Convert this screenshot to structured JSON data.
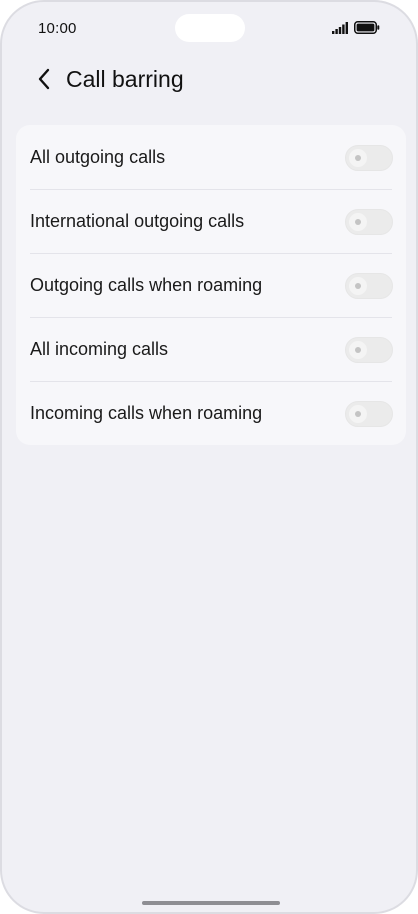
{
  "status_bar": {
    "time": "10:00",
    "icons": [
      "signal-icon",
      "battery-icon"
    ]
  },
  "header": {
    "back_icon": "chevron-left-icon",
    "title": "Call barring"
  },
  "settings": {
    "items": [
      {
        "label": "All outgoing calls",
        "enabled": false
      },
      {
        "label": "International outgoing calls",
        "enabled": false
      },
      {
        "label": "Outgoing calls when roaming",
        "enabled": false
      },
      {
        "label": "All incoming calls",
        "enabled": false
      },
      {
        "label": "Incoming calls when roaming",
        "enabled": false
      }
    ]
  },
  "colors": {
    "background": "#f0f0f5",
    "card": "#f7f7fa",
    "toggle_off": "#ebebeb"
  }
}
